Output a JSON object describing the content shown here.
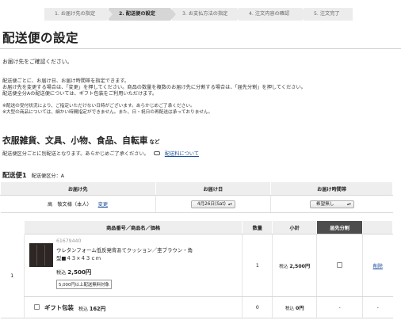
{
  "steps": [
    {
      "label": "1. お届け先の指定"
    },
    {
      "label": "2. 配送便の設定"
    },
    {
      "label": "3. お支払方法の指定"
    },
    {
      "label": "4. 注文内容の確認"
    },
    {
      "label": "5. 注文完了"
    }
  ],
  "page_title": "配送便の設定",
  "confirm_text": "お届け先をご確認ください。",
  "description": [
    "配送便ごとに、お届け日、お届け時間帯を指定できます。",
    "お届け先を変更する場合は、「変更」を押してください。商品の数量を複数のお届け先に分割する場合は、「届先分割」を押してください。",
    "配送便全分Aの配送便については、ギフト包装をご利用いただけます。"
  ],
  "notes": [
    "※配送の受付状況により、ご指定いただけない日時がございます。あらかじめご了承ください。",
    "※大型の商品については、細かい時間指定ができません。また、日・祝日の再配送は承っておりません。"
  ],
  "category": {
    "title": "衣服雑貨、文具、小物、食品、自転車",
    "suffix": "など",
    "desc": "配送便区分ごとに別配送となります。あらかじめご了承ください。",
    "fee_link": "配送料について"
  },
  "shipment": {
    "heading": "配送便1",
    "class_label": "配送便区分：A"
  },
  "delivery_table": {
    "headers": [
      "お届け先",
      "お届け日",
      "お届け時間帯"
    ],
    "recipient": "高　敬文様（本人）",
    "change_label": "変更",
    "date_value": "4月26日(Sat)",
    "time_value": "希望無し"
  },
  "items_table": {
    "headers": [
      "商品番号／商品名／価格",
      "数量",
      "小計",
      "届先分割"
    ],
    "row_number": "1",
    "product": {
      "code": "61679440",
      "name": "ウレタンフォーム低反発背あてクッション／杢ブラウン・角型■４３×４３ｃｍ",
      "price_prefix": "税込",
      "price": "2,500円",
      "badge": "5,000円以上配送無料対象",
      "quantity": "1",
      "subtotal_prefix": "税込",
      "subtotal": "2,500円",
      "delete_label": "削除"
    },
    "gift": {
      "label": "ギフト包装",
      "price_prefix": "税込",
      "price": "162円",
      "quantity": "0",
      "subtotal_prefix": "税込",
      "subtotal": "0円",
      "split": "-",
      "delete": "-"
    }
  },
  "icons": {
    "product_image": "cushion-image",
    "link": "link-icon",
    "select_arrow": "select-arrow-icon"
  },
  "colors": {
    "active_step": "#d6d6d6",
    "step": "#ececec",
    "split_header": "#4d4d4d",
    "link": "#1a4d99"
  }
}
